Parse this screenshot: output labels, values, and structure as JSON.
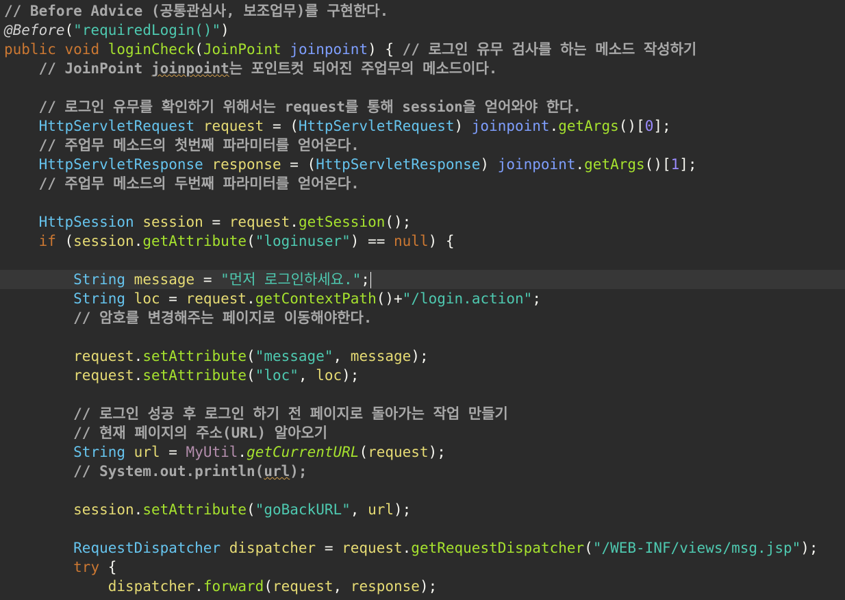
{
  "editor": {
    "lines": [
      {
        "indent": "",
        "tokens": [
          {
            "t": "// Before Advice (공통관심사, 보조업무)를 구현한다.",
            "c": "comment"
          }
        ]
      },
      {
        "indent": "",
        "tokens": [
          {
            "t": "@Before",
            "c": "annotation"
          },
          {
            "t": "(",
            "c": "plain"
          },
          {
            "t": "\"requiredLogin()\"",
            "c": "string"
          },
          {
            "t": ")",
            "c": "plain"
          }
        ]
      },
      {
        "indent": "",
        "tokens": [
          {
            "t": "public",
            "c": "keyword"
          },
          {
            "t": " ",
            "c": "plain"
          },
          {
            "t": "void",
            "c": "keyword"
          },
          {
            "t": " ",
            "c": "plain"
          },
          {
            "t": "loginCheck",
            "c": "method"
          },
          {
            "t": "(",
            "c": "plain"
          },
          {
            "t": "JoinPoint",
            "c": "type2"
          },
          {
            "t": " ",
            "c": "plain"
          },
          {
            "t": "joinpoint",
            "c": "param"
          },
          {
            "t": ") { ",
            "c": "plain"
          },
          {
            "t": "// 로그인 유무 검사를 하는 메소드 작성하기",
            "c": "comment"
          }
        ]
      },
      {
        "indent": "    ",
        "tokens": [
          {
            "t": "// JoinPoint ",
            "c": "comment"
          },
          {
            "t": "joinpoint",
            "c": "comment",
            "warn": true
          },
          {
            "t": "는 포인트컷 되어진 주업무의 메소드이다.",
            "c": "comment"
          }
        ]
      },
      {
        "indent": "",
        "tokens": []
      },
      {
        "indent": "    ",
        "tokens": [
          {
            "t": "// 로그인 유무를 확인하기 위해서는 request를 통해 session을 얻어와야 한다.",
            "c": "comment"
          }
        ]
      },
      {
        "indent": "    ",
        "tokens": [
          {
            "t": "HttpServletRequest",
            "c": "type"
          },
          {
            "t": " ",
            "c": "plain"
          },
          {
            "t": "request",
            "c": "var"
          },
          {
            "t": " = (",
            "c": "plain"
          },
          {
            "t": "HttpServletRequest",
            "c": "type"
          },
          {
            "t": ") ",
            "c": "plain"
          },
          {
            "t": "joinpoint",
            "c": "param"
          },
          {
            "t": ".",
            "c": "plain"
          },
          {
            "t": "getArgs",
            "c": "method"
          },
          {
            "t": "()[",
            "c": "plain"
          },
          {
            "t": "0",
            "c": "number"
          },
          {
            "t": "];",
            "c": "plain"
          }
        ]
      },
      {
        "indent": "    ",
        "tokens": [
          {
            "t": "// 주업무 메소드의 첫번째 파라미터를 얻어온다.",
            "c": "comment"
          }
        ]
      },
      {
        "indent": "    ",
        "tokens": [
          {
            "t": "HttpServletResponse",
            "c": "type"
          },
          {
            "t": " ",
            "c": "plain"
          },
          {
            "t": "response",
            "c": "var"
          },
          {
            "t": " = (",
            "c": "plain"
          },
          {
            "t": "HttpServletResponse",
            "c": "type"
          },
          {
            "t": ") ",
            "c": "plain"
          },
          {
            "t": "joinpoint",
            "c": "param"
          },
          {
            "t": ".",
            "c": "plain"
          },
          {
            "t": "getArgs",
            "c": "method"
          },
          {
            "t": "()[",
            "c": "plain"
          },
          {
            "t": "1",
            "c": "number"
          },
          {
            "t": "];",
            "c": "plain"
          }
        ]
      },
      {
        "indent": "    ",
        "tokens": [
          {
            "t": "// 주업무 메소드의 두번째 파라미터를 얻어온다.",
            "c": "comment"
          }
        ]
      },
      {
        "indent": "",
        "tokens": []
      },
      {
        "indent": "    ",
        "tokens": [
          {
            "t": "HttpSession",
            "c": "type"
          },
          {
            "t": " ",
            "c": "plain"
          },
          {
            "t": "session",
            "c": "var"
          },
          {
            "t": " = ",
            "c": "plain"
          },
          {
            "t": "request",
            "c": "var"
          },
          {
            "t": ".",
            "c": "plain"
          },
          {
            "t": "getSession",
            "c": "method"
          },
          {
            "t": "();",
            "c": "plain"
          }
        ]
      },
      {
        "indent": "    ",
        "tokens": [
          {
            "t": "if",
            "c": "keyword"
          },
          {
            "t": " (",
            "c": "plain"
          },
          {
            "t": "session",
            "c": "var"
          },
          {
            "t": ".",
            "c": "plain"
          },
          {
            "t": "getAttribute",
            "c": "method"
          },
          {
            "t": "(",
            "c": "plain"
          },
          {
            "t": "\"loginuser\"",
            "c": "string"
          },
          {
            "t": ") == ",
            "c": "plain"
          },
          {
            "t": "null",
            "c": "keyword"
          },
          {
            "t": ") {",
            "c": "plain"
          }
        ]
      },
      {
        "indent": "",
        "tokens": []
      },
      {
        "indent": "        ",
        "current": true,
        "caret": true,
        "tokens": [
          {
            "t": "String",
            "c": "type"
          },
          {
            "t": " ",
            "c": "plain"
          },
          {
            "t": "message",
            "c": "var"
          },
          {
            "t": " = ",
            "c": "plain"
          },
          {
            "t": "\"먼저 로그인하세요.\"",
            "c": "string"
          },
          {
            "t": ";",
            "c": "plain"
          }
        ]
      },
      {
        "indent": "        ",
        "tokens": [
          {
            "t": "String",
            "c": "type"
          },
          {
            "t": " ",
            "c": "plain"
          },
          {
            "t": "loc",
            "c": "var"
          },
          {
            "t": " = ",
            "c": "plain"
          },
          {
            "t": "request",
            "c": "var"
          },
          {
            "t": ".",
            "c": "plain"
          },
          {
            "t": "getContextPath",
            "c": "method"
          },
          {
            "t": "()+",
            "c": "plain"
          },
          {
            "t": "\"/login.action\"",
            "c": "string"
          },
          {
            "t": ";",
            "c": "plain"
          }
        ]
      },
      {
        "indent": "        ",
        "tokens": [
          {
            "t": "// 암호를 변경해주는 페이지로 이동해야한다.",
            "c": "comment"
          }
        ]
      },
      {
        "indent": "",
        "tokens": []
      },
      {
        "indent": "        ",
        "tokens": [
          {
            "t": "request",
            "c": "var"
          },
          {
            "t": ".",
            "c": "plain"
          },
          {
            "t": "setAttribute",
            "c": "method"
          },
          {
            "t": "(",
            "c": "plain"
          },
          {
            "t": "\"message\"",
            "c": "string"
          },
          {
            "t": ", ",
            "c": "plain"
          },
          {
            "t": "message",
            "c": "var"
          },
          {
            "t": ");",
            "c": "plain"
          }
        ]
      },
      {
        "indent": "        ",
        "tokens": [
          {
            "t": "request",
            "c": "var"
          },
          {
            "t": ".",
            "c": "plain"
          },
          {
            "t": "setAttribute",
            "c": "method"
          },
          {
            "t": "(",
            "c": "plain"
          },
          {
            "t": "\"loc\"",
            "c": "string"
          },
          {
            "t": ", ",
            "c": "plain"
          },
          {
            "t": "loc",
            "c": "var"
          },
          {
            "t": ");",
            "c": "plain"
          }
        ]
      },
      {
        "indent": "",
        "tokens": []
      },
      {
        "indent": "        ",
        "tokens": [
          {
            "t": "// 로그인 성공 후 로그인 하기 전 페이지로 돌아가는 작업 만들기",
            "c": "comment"
          }
        ]
      },
      {
        "indent": "        ",
        "tokens": [
          {
            "t": "// 현재 페이지의 주소(URL) 알아오기",
            "c": "comment"
          }
        ]
      },
      {
        "indent": "        ",
        "tokens": [
          {
            "t": "String",
            "c": "type"
          },
          {
            "t": " ",
            "c": "plain"
          },
          {
            "t": "url",
            "c": "var"
          },
          {
            "t": " = ",
            "c": "plain"
          },
          {
            "t": "MyUtil",
            "c": "class-ref"
          },
          {
            "t": ".",
            "c": "plain"
          },
          {
            "t": "getCurrentURL",
            "c": "italic-method"
          },
          {
            "t": "(",
            "c": "plain"
          },
          {
            "t": "request",
            "c": "var"
          },
          {
            "t": ");",
            "c": "plain"
          }
        ]
      },
      {
        "indent": "        ",
        "tokens": [
          {
            "t": "// System.out.println(",
            "c": "comment"
          },
          {
            "t": "url",
            "c": "comment",
            "warn": true
          },
          {
            "t": ");",
            "c": "comment"
          }
        ]
      },
      {
        "indent": "",
        "tokens": []
      },
      {
        "indent": "        ",
        "tokens": [
          {
            "t": "session",
            "c": "var"
          },
          {
            "t": ".",
            "c": "plain"
          },
          {
            "t": "setAttribute",
            "c": "method"
          },
          {
            "t": "(",
            "c": "plain"
          },
          {
            "t": "\"goBackURL\"",
            "c": "string"
          },
          {
            "t": ", ",
            "c": "plain"
          },
          {
            "t": "url",
            "c": "var"
          },
          {
            "t": ");",
            "c": "plain"
          }
        ]
      },
      {
        "indent": "",
        "tokens": []
      },
      {
        "indent": "        ",
        "tokens": [
          {
            "t": "RequestDispatcher",
            "c": "type"
          },
          {
            "t": " ",
            "c": "plain"
          },
          {
            "t": "dispatcher",
            "c": "var"
          },
          {
            "t": " = ",
            "c": "plain"
          },
          {
            "t": "request",
            "c": "var"
          },
          {
            "t": ".",
            "c": "plain"
          },
          {
            "t": "getRequestDispatcher",
            "c": "method"
          },
          {
            "t": "(",
            "c": "plain"
          },
          {
            "t": "\"/WEB-INF/views/msg.jsp\"",
            "c": "string"
          },
          {
            "t": ");",
            "c": "plain"
          }
        ]
      },
      {
        "indent": "        ",
        "tokens": [
          {
            "t": "try",
            "c": "keyword"
          },
          {
            "t": " {",
            "c": "plain"
          }
        ]
      },
      {
        "indent": "            ",
        "tokens": [
          {
            "t": "dispatcher",
            "c": "var"
          },
          {
            "t": ".",
            "c": "plain"
          },
          {
            "t": "forward",
            "c": "method"
          },
          {
            "t": "(",
            "c": "plain"
          },
          {
            "t": "request",
            "c": "var"
          },
          {
            "t": ", ",
            "c": "plain"
          },
          {
            "t": "response",
            "c": "var"
          },
          {
            "t": ");",
            "c": "plain"
          }
        ]
      }
    ]
  }
}
